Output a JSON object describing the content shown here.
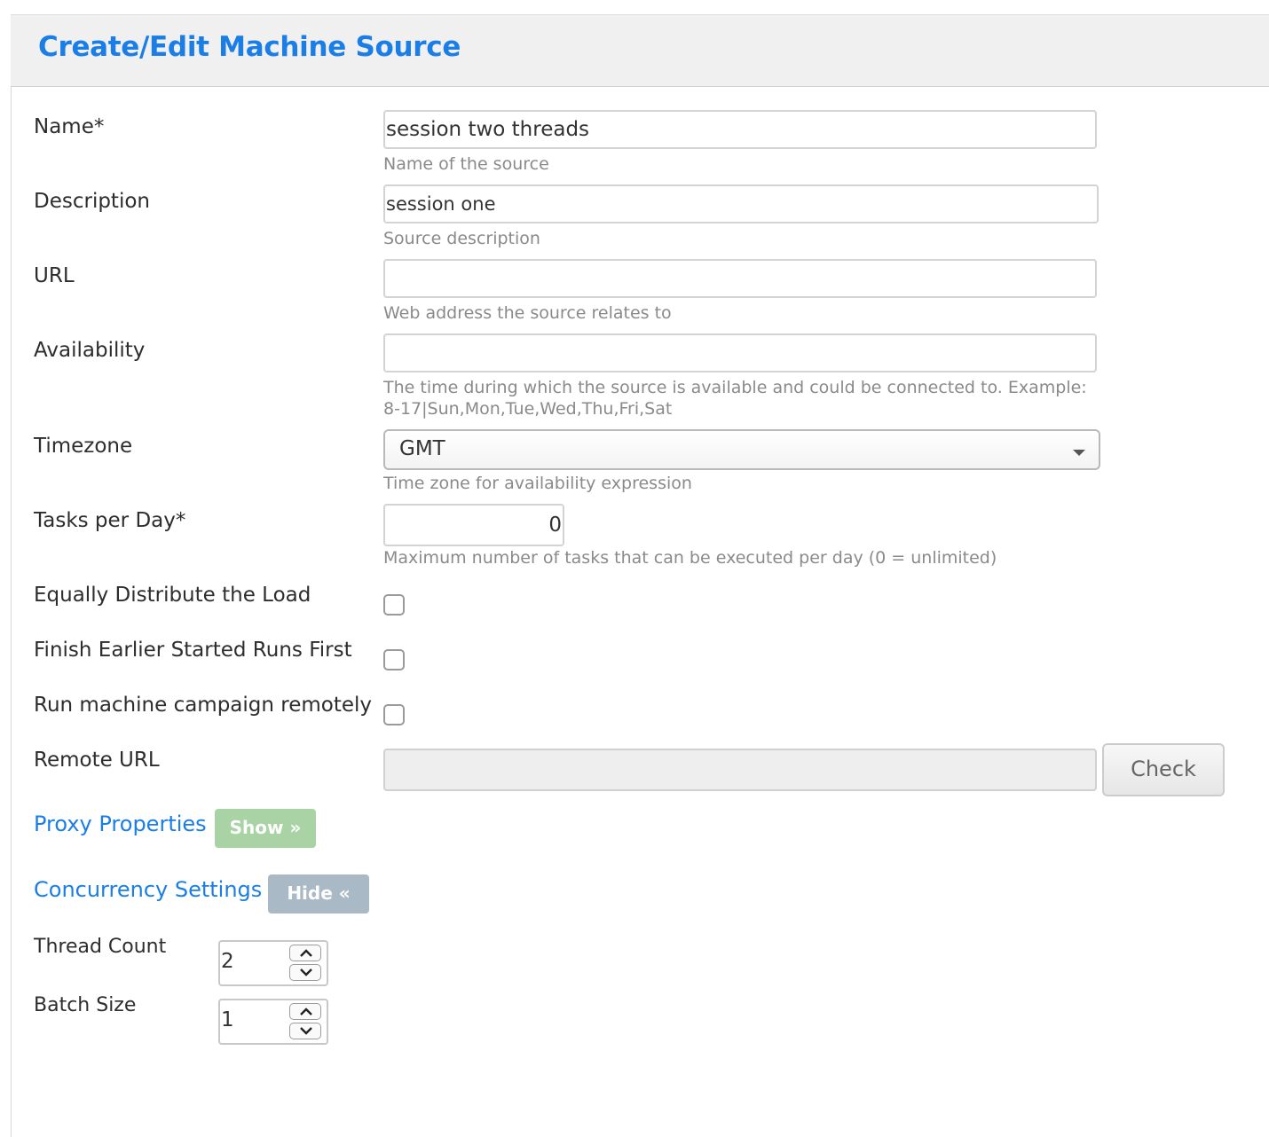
{
  "header": {
    "title": "Create/Edit Machine Source"
  },
  "fields": {
    "name": {
      "label": "Name*",
      "value": "session two threads",
      "help": "Name of the source"
    },
    "description": {
      "label": "Description",
      "value": "session one",
      "help": "Source description"
    },
    "url": {
      "label": "URL",
      "value": "",
      "help": "Web address the source relates to"
    },
    "availability": {
      "label": "Availability",
      "value": "",
      "help_line1": "The time during which the source is available and could be connected to. Example:",
      "help_line2": "8-17|Sun,Mon,Tue,Wed,Thu,Fri,Sat"
    },
    "timezone": {
      "label": "Timezone",
      "value": "GMT",
      "help": "Time zone for availability expression"
    },
    "tasks_per_day": {
      "label": "Tasks per Day*",
      "value": "0",
      "help": "Maximum number of tasks that can be executed per day (0 = unlimited)"
    },
    "equally_distribute": {
      "label": "Equally Distribute the Load",
      "checked": false
    },
    "finish_earlier": {
      "label": "Finish Earlier Started Runs First",
      "checked": false
    },
    "run_remotely": {
      "label": "Run machine campaign remotely",
      "checked": false
    },
    "remote_url": {
      "label": "Remote URL",
      "value": "",
      "button": "Check"
    }
  },
  "proxy": {
    "title": "Proxy Properties",
    "toggle": "Show »"
  },
  "concurrency": {
    "title": "Concurrency Settings",
    "toggle": "Hide «",
    "thread_count": {
      "label": "Thread Count",
      "value": "2"
    },
    "batch_size": {
      "label": "Batch Size",
      "value": "1"
    }
  },
  "colors": {
    "accent": "#1a7ee6",
    "show_button": "#a9d3a5",
    "hide_button": "#a9b9c6",
    "header_bg": "#f0f0f0"
  }
}
